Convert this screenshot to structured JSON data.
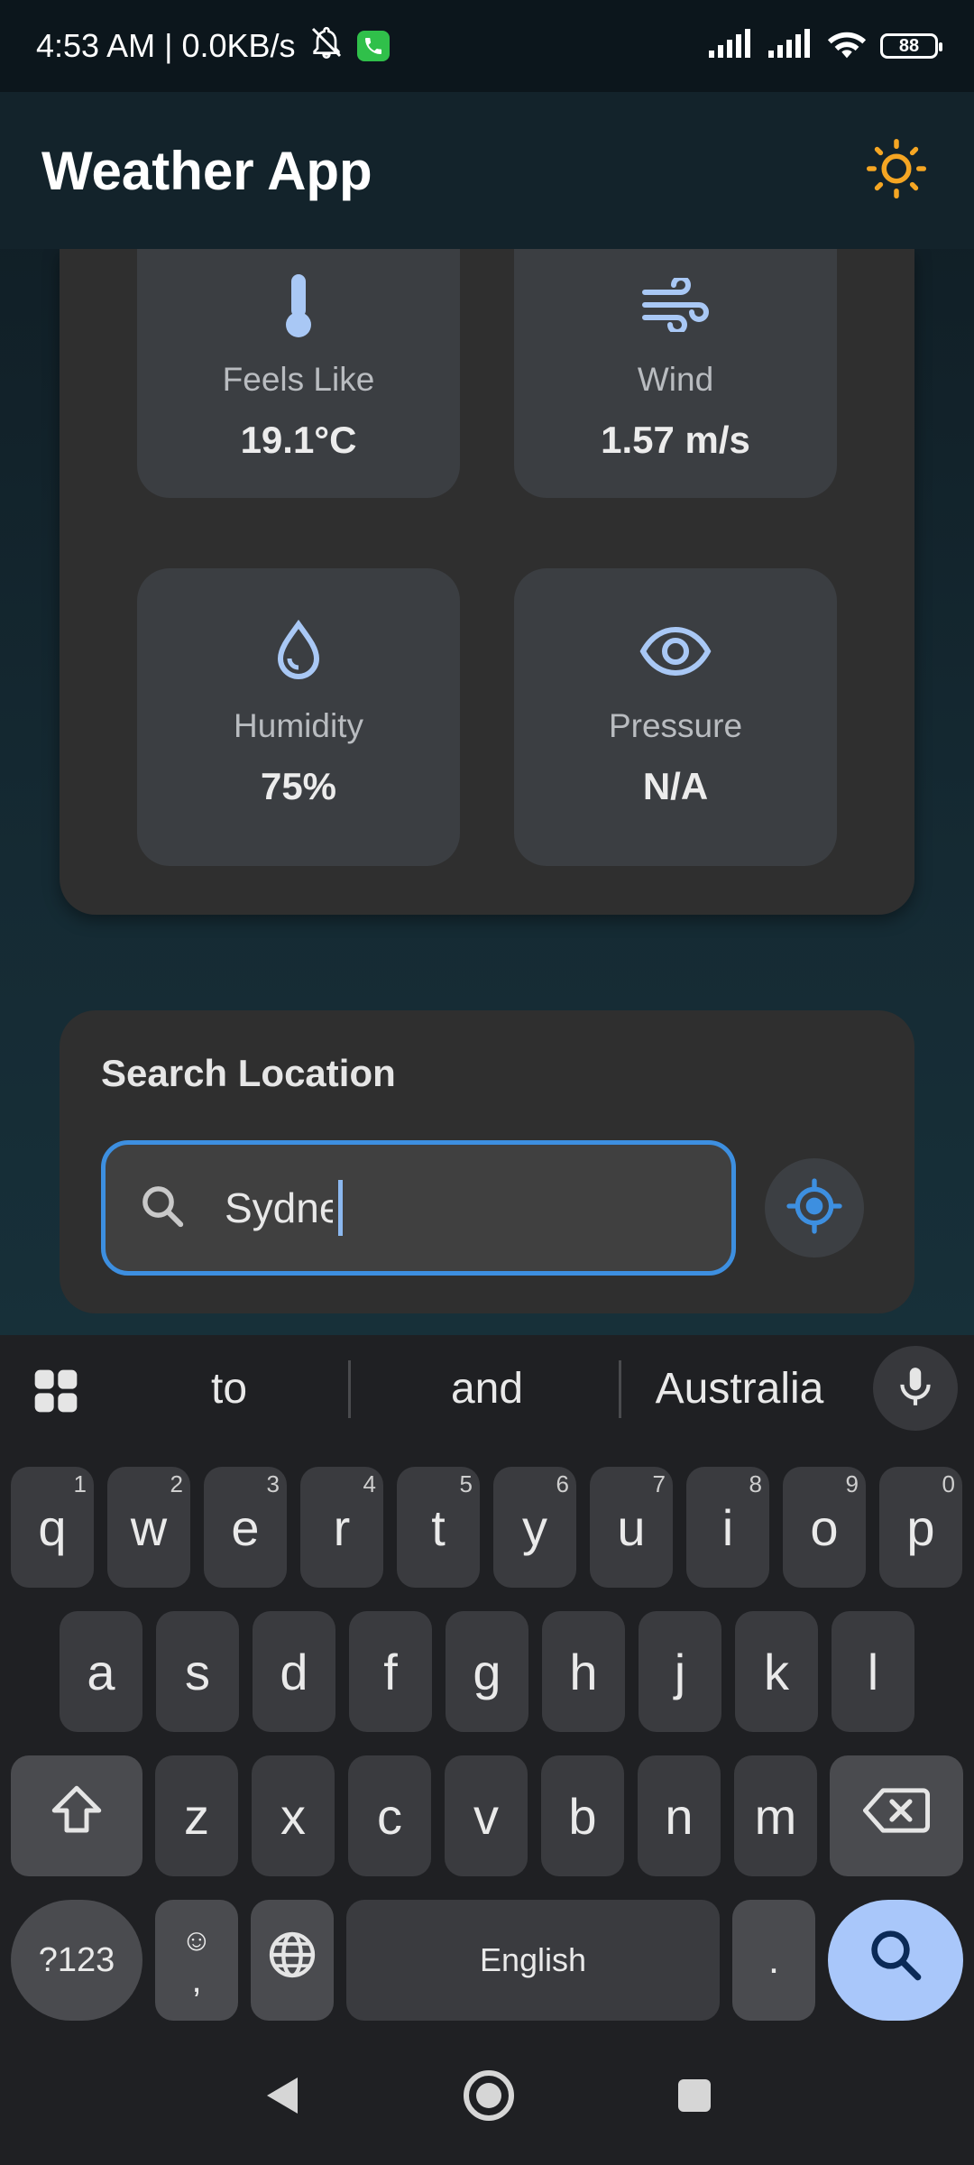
{
  "status_bar": {
    "time_info": "4:53 AM | 0.0KB/s",
    "battery": "88"
  },
  "app_bar": {
    "title": "Weather App",
    "theme_icon": "sun-icon"
  },
  "details": {
    "tiles": [
      {
        "label": "Feels Like",
        "value": "19.1°C",
        "icon": "thermometer-icon"
      },
      {
        "label": "Wind",
        "value": "1.57 m/s",
        "icon": "wind-icon"
      },
      {
        "label": "Humidity",
        "value": "75%",
        "icon": "water-drop-icon"
      },
      {
        "label": "Pressure",
        "value": "N/A",
        "icon": "eye-icon"
      }
    ]
  },
  "search": {
    "title": "Search Location",
    "value": "Sydney",
    "location_icon": "my-location-icon"
  },
  "keyboard": {
    "suggestions": [
      "to",
      "and",
      "Australia"
    ],
    "row1": [
      {
        "k": "q",
        "h": "1"
      },
      {
        "k": "w",
        "h": "2"
      },
      {
        "k": "e",
        "h": "3"
      },
      {
        "k": "r",
        "h": "4"
      },
      {
        "k": "t",
        "h": "5"
      },
      {
        "k": "y",
        "h": "6"
      },
      {
        "k": "u",
        "h": "7"
      },
      {
        "k": "i",
        "h": "8"
      },
      {
        "k": "o",
        "h": "9"
      },
      {
        "k": "p",
        "h": "0"
      }
    ],
    "row2": [
      "a",
      "s",
      "d",
      "f",
      "g",
      "h",
      "j",
      "k",
      "l"
    ],
    "row3": [
      "z",
      "x",
      "c",
      "v",
      "b",
      "n",
      "m"
    ],
    "symbols_key": "?123",
    "emoji_comma_key": ",",
    "space_key": "English",
    "period_key": "."
  },
  "colors": {
    "accent": "#3d8fe0",
    "icon_blue": "#a9c8f5",
    "sun": "#f5a623",
    "search_key": "#a9c7fa"
  }
}
